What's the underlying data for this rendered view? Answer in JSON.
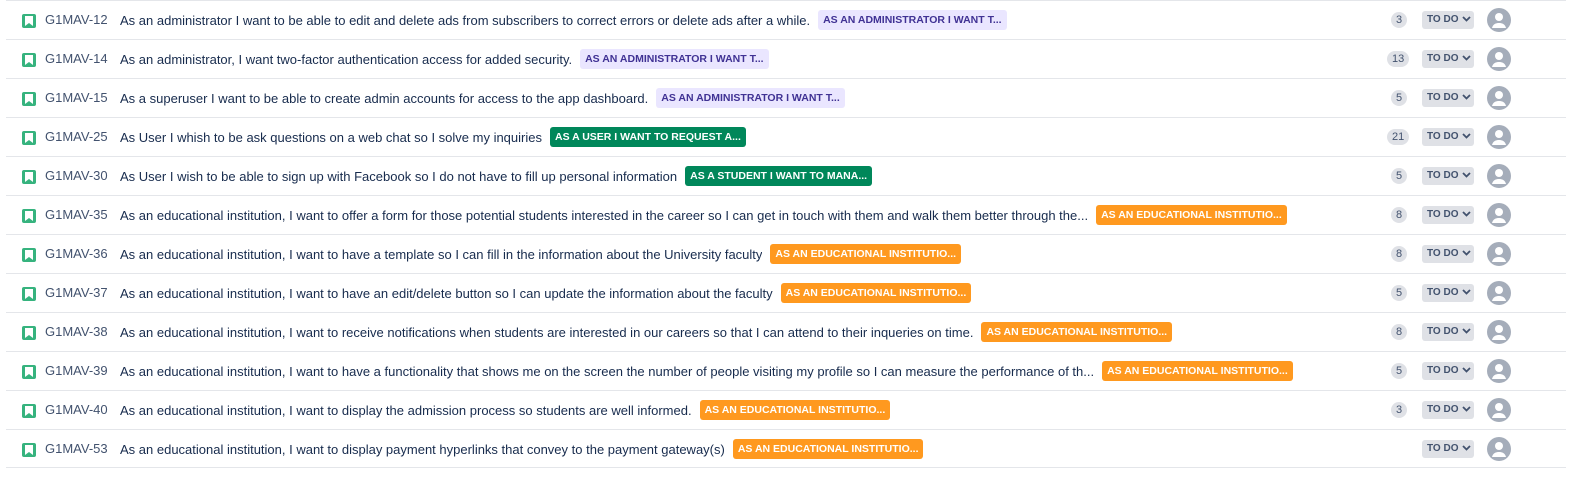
{
  "colors": {
    "story_icon": "#36b37e",
    "epic_purple_bg": "#eae6ff",
    "epic_purple_text": "#403294",
    "epic_green_bg": "#00875a",
    "epic_orange_bg": "#ff991f",
    "avatar": "#a5adba"
  },
  "issues": [
    {
      "key": "G1MAV-12",
      "summary": "As an administrator I want to be able to edit and delete ads from subscribers to correct errors or delete ads after a while.",
      "epic": "AS AN ADMINISTRATOR I WANT T...",
      "epic_color": "purple",
      "points": "3",
      "status": "TO DO",
      "icon": "story-bookmark-icon",
      "avatar_icon": "unassigned-user-icon"
    },
    {
      "key": "G1MAV-14",
      "summary": "As an administrator, I want two-factor authentication access for added security.",
      "epic": "AS AN ADMINISTRATOR I WANT T...",
      "epic_color": "purple",
      "points": "13",
      "status": "TO DO",
      "icon": "story-bookmark-icon",
      "avatar_icon": "unassigned-user-icon"
    },
    {
      "key": "G1MAV-15",
      "summary": "As a superuser I want to be able to create admin accounts for access to the app dashboard.",
      "epic": "AS AN ADMINISTRATOR I WANT T...",
      "epic_color": "purple",
      "points": "5",
      "status": "TO DO",
      "icon": "story-bookmark-icon",
      "avatar_icon": "unassigned-user-icon"
    },
    {
      "key": "G1MAV-25",
      "summary": "As User I whish to be ask questions on a web chat so I solve my inquiries",
      "epic": "AS A USER I WANT TO REQUEST A...",
      "epic_color": "green",
      "points": "21",
      "status": "TO DO",
      "icon": "story-bookmark-icon",
      "avatar_icon": "unassigned-user-icon"
    },
    {
      "key": "G1MAV-30",
      "summary": "As User I wish to be able to sign up with Facebook so I do not have to fill up personal information",
      "epic": "AS A STUDENT I WANT TO MANA...",
      "epic_color": "green",
      "points": "5",
      "status": "TO DO",
      "icon": "story-bookmark-icon",
      "avatar_icon": "unassigned-user-icon"
    },
    {
      "key": "G1MAV-35",
      "summary": "As an educational institution, I want to offer a form for those potential students interested in the career so I can get in touch with them and walk them better through the...",
      "epic": "AS AN EDUCATIONAL INSTITUTIO...",
      "epic_color": "orange",
      "points": "8",
      "status": "TO DO",
      "icon": "story-bookmark-icon",
      "avatar_icon": "unassigned-user-icon"
    },
    {
      "key": "G1MAV-36",
      "summary": "As an educational institution, I want to have a template so I can fill in the information about the University faculty",
      "epic": "AS AN EDUCATIONAL INSTITUTIO...",
      "epic_color": "orange",
      "points": "8",
      "status": "TO DO",
      "icon": "story-bookmark-icon",
      "avatar_icon": "unassigned-user-icon"
    },
    {
      "key": "G1MAV-37",
      "summary": "As an educational institution, I want to have an edit/delete button so I can update the information about the faculty",
      "epic": "AS AN EDUCATIONAL INSTITUTIO...",
      "epic_color": "orange",
      "points": "5",
      "status": "TO DO",
      "icon": "story-bookmark-icon",
      "avatar_icon": "unassigned-user-icon"
    },
    {
      "key": "G1MAV-38",
      "summary": "As an educational institution, I want to receive notifications when students are interested in our careers so that I can attend to their inqueries on time.",
      "epic": "AS AN EDUCATIONAL INSTITUTIO...",
      "epic_color": "orange",
      "points": "8",
      "status": "TO DO",
      "icon": "story-bookmark-icon",
      "avatar_icon": "unassigned-user-icon"
    },
    {
      "key": "G1MAV-39",
      "summary": "As an educational institution, I want to have a functionality that shows me on the screen the number of people visiting my profile so I can measure the performance of th...",
      "epic": "AS AN EDUCATIONAL INSTITUTIO...",
      "epic_color": "orange",
      "points": "5",
      "status": "TO DO",
      "icon": "story-bookmark-icon",
      "avatar_icon": "unassigned-user-icon"
    },
    {
      "key": "G1MAV-40",
      "summary": "As an educational institution, I want to display the admission process so students are well informed.",
      "epic": "AS AN EDUCATIONAL INSTITUTIO...",
      "epic_color": "orange",
      "points": "3",
      "status": "TO DO",
      "icon": "story-bookmark-icon",
      "avatar_icon": "unassigned-user-icon"
    },
    {
      "key": "G1MAV-53",
      "summary": "As an educational institution, I want to display payment hyperlinks that convey to the payment gateway(s)",
      "epic": "AS AN EDUCATIONAL INSTITUTIO...",
      "epic_color": "orange",
      "points": "",
      "status": "TO DO",
      "icon": "story-bookmark-icon",
      "avatar_icon": "unassigned-user-icon"
    }
  ]
}
